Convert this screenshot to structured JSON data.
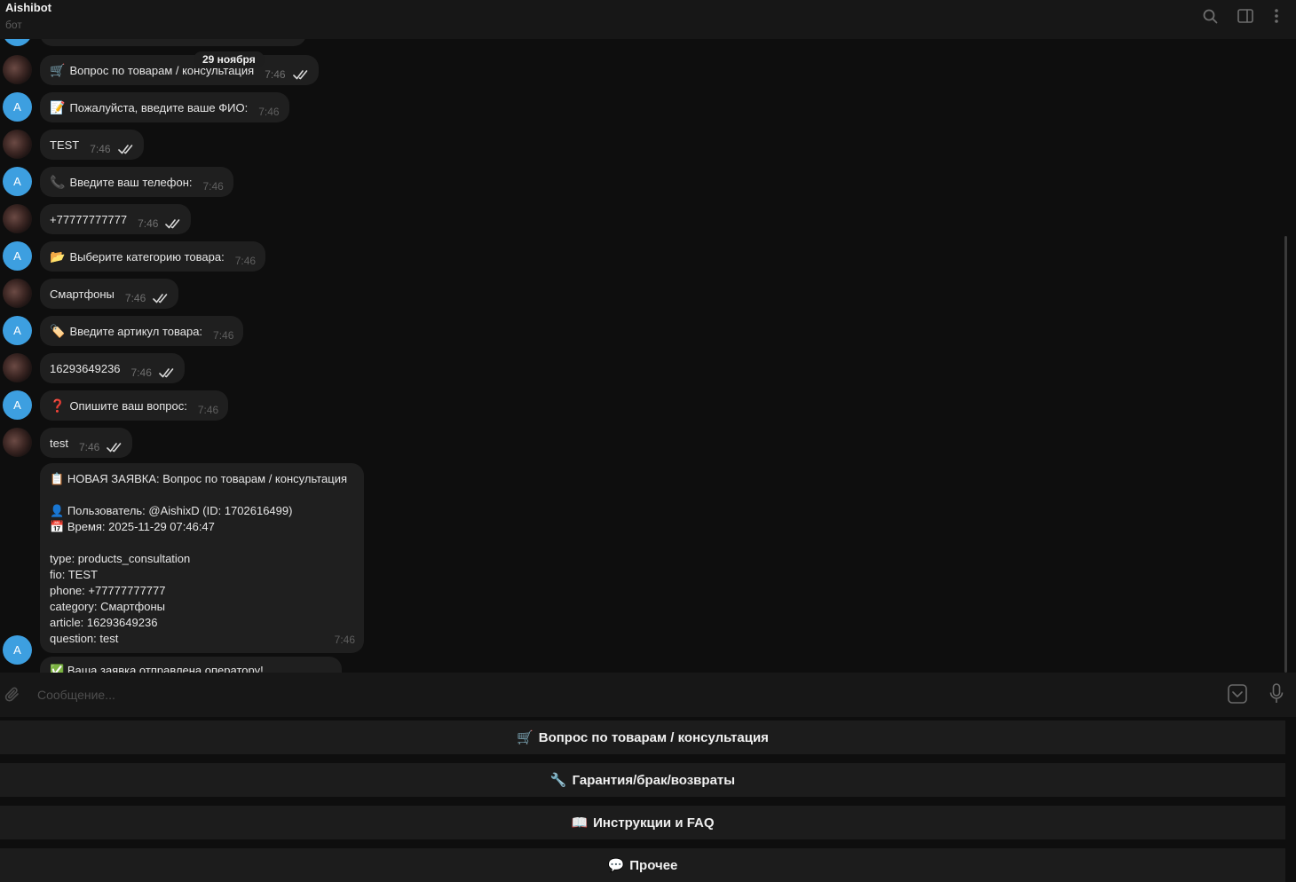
{
  "header": {
    "title": "Aishibot",
    "subtitle": "бот"
  },
  "chat": {
    "date": "29 ноября",
    "bot_avatar_letter": "A",
    "messages": [
      {
        "from": "user",
        "emoji": "🛒",
        "text": "Вопрос по товарам / консультация",
        "time": "7:46"
      },
      {
        "from": "bot",
        "emoji": "📝",
        "text": "Пожалуйста, введите ваше ФИО:",
        "time": "7:46"
      },
      {
        "from": "user",
        "emoji": "",
        "text": "TEST",
        "time": "7:46"
      },
      {
        "from": "bot",
        "emoji": "📞",
        "text": "Введите ваш телефон:",
        "time": "7:46"
      },
      {
        "from": "user",
        "emoji": "",
        "text": "+77777777777",
        "time": "7:46"
      },
      {
        "from": "bot",
        "emoji": "📂",
        "text": "Выберите категорию товара:",
        "time": "7:46"
      },
      {
        "from": "user",
        "emoji": "",
        "text": "Смартфоны",
        "time": "7:46"
      },
      {
        "from": "bot",
        "emoji": "🏷️",
        "text": "Введите артикул товара:",
        "time": "7:46"
      },
      {
        "from": "user",
        "emoji": "",
        "text": "16293649236",
        "time": "7:46"
      },
      {
        "from": "bot",
        "emoji": "❓",
        "text": "Опишите ваш вопрос:",
        "time": "7:46"
      },
      {
        "from": "user",
        "emoji": "",
        "text": "test",
        "time": "7:46"
      }
    ],
    "summary": {
      "title_emoji": "📋",
      "title": "НОВАЯ ЗАЯВКА: Вопрос по товарам / консультация",
      "user_emoji": "👤",
      "user": "Пользователь: @AishixD (ID: 1702616499)",
      "time_emoji": "📅",
      "time_line": "Время: 2025-11-29 07:46:47",
      "fields": [
        "type: products_consultation",
        "fio: TEST",
        "phone: +77777777777",
        "category: Смартфоны",
        "article: 16293649236",
        "question: test"
      ],
      "time": "7:46"
    },
    "last_message": {
      "emoji": "✅",
      "text": "Ваша заявка отправлена оператору!"
    }
  },
  "composer": {
    "placeholder": "Сообщение..."
  },
  "keyboard": [
    {
      "emoji": "🛒",
      "label": "Вопрос по товарам / консультация"
    },
    {
      "emoji": "🔧",
      "label": "Гарантия/брак/возвраты"
    },
    {
      "emoji": "📖",
      "label": "Инструкции и FAQ"
    },
    {
      "emoji": "💬",
      "label": "Прочее"
    }
  ]
}
